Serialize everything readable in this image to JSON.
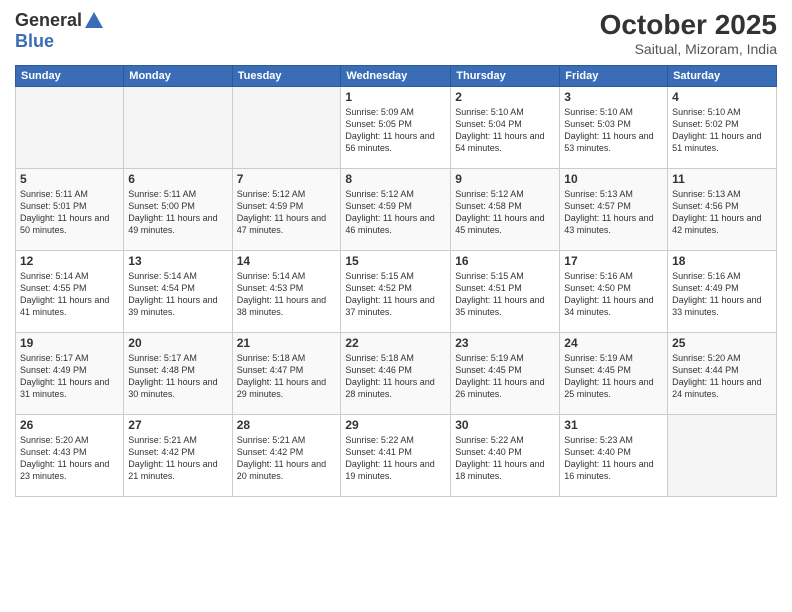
{
  "header": {
    "logo_line1": "General",
    "logo_line2": "Blue",
    "month": "October 2025",
    "location": "Saitual, Mizoram, India"
  },
  "weekdays": [
    "Sunday",
    "Monday",
    "Tuesday",
    "Wednesday",
    "Thursday",
    "Friday",
    "Saturday"
  ],
  "weeks": [
    [
      {
        "day": "",
        "info": ""
      },
      {
        "day": "",
        "info": ""
      },
      {
        "day": "",
        "info": ""
      },
      {
        "day": "1",
        "info": "Sunrise: 5:09 AM\nSunset: 5:05 PM\nDaylight: 11 hours and 56 minutes."
      },
      {
        "day": "2",
        "info": "Sunrise: 5:10 AM\nSunset: 5:04 PM\nDaylight: 11 hours and 54 minutes."
      },
      {
        "day": "3",
        "info": "Sunrise: 5:10 AM\nSunset: 5:03 PM\nDaylight: 11 hours and 53 minutes."
      },
      {
        "day": "4",
        "info": "Sunrise: 5:10 AM\nSunset: 5:02 PM\nDaylight: 11 hours and 51 minutes."
      }
    ],
    [
      {
        "day": "5",
        "info": "Sunrise: 5:11 AM\nSunset: 5:01 PM\nDaylight: 11 hours and 50 minutes."
      },
      {
        "day": "6",
        "info": "Sunrise: 5:11 AM\nSunset: 5:00 PM\nDaylight: 11 hours and 49 minutes."
      },
      {
        "day": "7",
        "info": "Sunrise: 5:12 AM\nSunset: 4:59 PM\nDaylight: 11 hours and 47 minutes."
      },
      {
        "day": "8",
        "info": "Sunrise: 5:12 AM\nSunset: 4:59 PM\nDaylight: 11 hours and 46 minutes."
      },
      {
        "day": "9",
        "info": "Sunrise: 5:12 AM\nSunset: 4:58 PM\nDaylight: 11 hours and 45 minutes."
      },
      {
        "day": "10",
        "info": "Sunrise: 5:13 AM\nSunset: 4:57 PM\nDaylight: 11 hours and 43 minutes."
      },
      {
        "day": "11",
        "info": "Sunrise: 5:13 AM\nSunset: 4:56 PM\nDaylight: 11 hours and 42 minutes."
      }
    ],
    [
      {
        "day": "12",
        "info": "Sunrise: 5:14 AM\nSunset: 4:55 PM\nDaylight: 11 hours and 41 minutes."
      },
      {
        "day": "13",
        "info": "Sunrise: 5:14 AM\nSunset: 4:54 PM\nDaylight: 11 hours and 39 minutes."
      },
      {
        "day": "14",
        "info": "Sunrise: 5:14 AM\nSunset: 4:53 PM\nDaylight: 11 hours and 38 minutes."
      },
      {
        "day": "15",
        "info": "Sunrise: 5:15 AM\nSunset: 4:52 PM\nDaylight: 11 hours and 37 minutes."
      },
      {
        "day": "16",
        "info": "Sunrise: 5:15 AM\nSunset: 4:51 PM\nDaylight: 11 hours and 35 minutes."
      },
      {
        "day": "17",
        "info": "Sunrise: 5:16 AM\nSunset: 4:50 PM\nDaylight: 11 hours and 34 minutes."
      },
      {
        "day": "18",
        "info": "Sunrise: 5:16 AM\nSunset: 4:49 PM\nDaylight: 11 hours and 33 minutes."
      }
    ],
    [
      {
        "day": "19",
        "info": "Sunrise: 5:17 AM\nSunset: 4:49 PM\nDaylight: 11 hours and 31 minutes."
      },
      {
        "day": "20",
        "info": "Sunrise: 5:17 AM\nSunset: 4:48 PM\nDaylight: 11 hours and 30 minutes."
      },
      {
        "day": "21",
        "info": "Sunrise: 5:18 AM\nSunset: 4:47 PM\nDaylight: 11 hours and 29 minutes."
      },
      {
        "day": "22",
        "info": "Sunrise: 5:18 AM\nSunset: 4:46 PM\nDaylight: 11 hours and 28 minutes."
      },
      {
        "day": "23",
        "info": "Sunrise: 5:19 AM\nSunset: 4:45 PM\nDaylight: 11 hours and 26 minutes."
      },
      {
        "day": "24",
        "info": "Sunrise: 5:19 AM\nSunset: 4:45 PM\nDaylight: 11 hours and 25 minutes."
      },
      {
        "day": "25",
        "info": "Sunrise: 5:20 AM\nSunset: 4:44 PM\nDaylight: 11 hours and 24 minutes."
      }
    ],
    [
      {
        "day": "26",
        "info": "Sunrise: 5:20 AM\nSunset: 4:43 PM\nDaylight: 11 hours and 23 minutes."
      },
      {
        "day": "27",
        "info": "Sunrise: 5:21 AM\nSunset: 4:42 PM\nDaylight: 11 hours and 21 minutes."
      },
      {
        "day": "28",
        "info": "Sunrise: 5:21 AM\nSunset: 4:42 PM\nDaylight: 11 hours and 20 minutes."
      },
      {
        "day": "29",
        "info": "Sunrise: 5:22 AM\nSunset: 4:41 PM\nDaylight: 11 hours and 19 minutes."
      },
      {
        "day": "30",
        "info": "Sunrise: 5:22 AM\nSunset: 4:40 PM\nDaylight: 11 hours and 18 minutes."
      },
      {
        "day": "31",
        "info": "Sunrise: 5:23 AM\nSunset: 4:40 PM\nDaylight: 11 hours and 16 minutes."
      },
      {
        "day": "",
        "info": ""
      }
    ]
  ]
}
